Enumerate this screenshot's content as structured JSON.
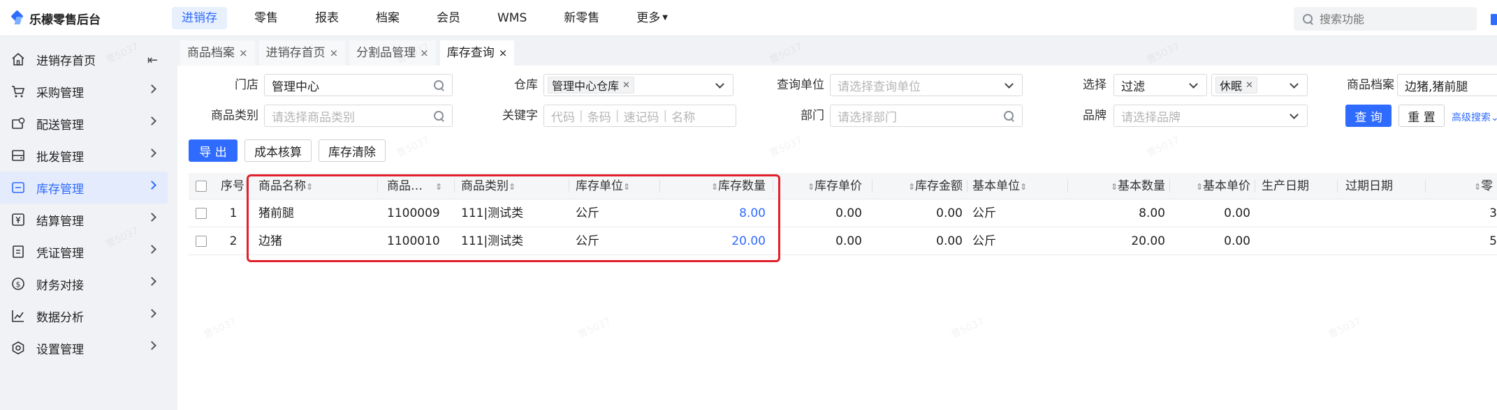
{
  "app": {
    "title": "乐檬零售后台"
  },
  "topnav": [
    {
      "label": "进销存",
      "active": true
    },
    {
      "label": "零售"
    },
    {
      "label": "报表"
    },
    {
      "label": "档案"
    },
    {
      "label": "会员"
    },
    {
      "label": "WMS"
    },
    {
      "label": "新零售"
    },
    {
      "label": "更多"
    }
  ],
  "search": {
    "placeholder": "搜索功能"
  },
  "sidebar": {
    "items": [
      {
        "label": "进销存首页",
        "icon": "home-icon"
      },
      {
        "label": "采购管理",
        "icon": "cart-icon"
      },
      {
        "label": "配送管理",
        "icon": "box-icon"
      },
      {
        "label": "批发管理",
        "icon": "archive-icon"
      },
      {
        "label": "库存管理",
        "icon": "inventory-icon",
        "active": true
      },
      {
        "label": "结算管理",
        "icon": "yen-icon"
      },
      {
        "label": "凭证管理",
        "icon": "voucher-icon"
      },
      {
        "label": "财务对接",
        "icon": "dollar-icon"
      },
      {
        "label": "数据分析",
        "icon": "chart-icon"
      },
      {
        "label": "设置管理",
        "icon": "settings-icon"
      }
    ]
  },
  "tabs": [
    {
      "label": "商品档案"
    },
    {
      "label": "进销存首页"
    },
    {
      "label": "分割品管理"
    },
    {
      "label": "库存查询",
      "active": true
    }
  ],
  "filters": {
    "store_label": "门店",
    "store_value": "管理中心",
    "warehouse_label": "仓库",
    "warehouse_tag": "管理中心仓库",
    "query_unit_label": "查询单位",
    "query_unit_placeholder": "请选择查询单位",
    "select_label": "选择",
    "select_value": "过滤",
    "select_tag": "休眠",
    "product_file_label": "商品档案",
    "product_file_value": "边猪,猪前腿",
    "category_label": "商品类别",
    "category_placeholder": "请选择商品类别",
    "keyword_label": "关键字",
    "keyword_placeholder": [
      "代码",
      "条码",
      "速记码",
      "名称"
    ],
    "dept_label": "部门",
    "dept_placeholder": "请选择部门",
    "brand_label": "品牌",
    "brand_placeholder": "请选择品牌"
  },
  "buttons": {
    "query": "查 询",
    "reset": "重 置",
    "advanced": "高级搜索",
    "export": "导 出",
    "cost": "成本核算",
    "clear": "库存清除"
  },
  "table": {
    "columns": [
      "序号",
      "商品名称",
      "商品…",
      "商品类别",
      "库存单位",
      "库存数量",
      "库存单价",
      "库存金额",
      "基本单位",
      "基本数量",
      "基本单价",
      "生产日期",
      "过期日期",
      "零"
    ],
    "rows": [
      {
        "idx": "1",
        "name": "猪前腿",
        "code": "1100009",
        "category": "111|测试类",
        "unit": "公斤",
        "qty": "8.00",
        "price": "0.00",
        "amount": "0.00",
        "base_unit": "公斤",
        "base_qty": "8.00",
        "base_price": "0.00",
        "prod_date": "",
        "exp_date": "",
        "extra": "3"
      },
      {
        "idx": "2",
        "name": "边猪",
        "code": "1100010",
        "category": "111|测试类",
        "unit": "公斤",
        "qty": "20.00",
        "price": "0.00",
        "amount": "0.00",
        "base_unit": "公斤",
        "base_qty": "20.00",
        "base_price": "0.00",
        "prod_date": "",
        "exp_date": "",
        "extra": "5"
      }
    ]
  },
  "watermark": "曹5037"
}
